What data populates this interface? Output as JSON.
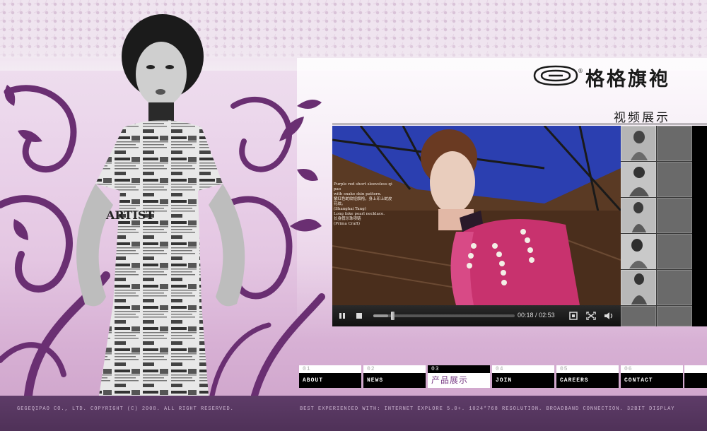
{
  "brand": {
    "name": "格格旗袍",
    "registered_mark": "®"
  },
  "section_title": "视频展示",
  "video": {
    "caption_lines": [
      "Purple red short sleeveless qi pao",
      "with snake skin pattern.",
      "紫红色蛇纹短旗袍，身上印上蛇皮",
      "花纹。",
      "(Shanghai Tang)",
      "Long fake pearl necklace.",
      "长身假珍珠项链",
      "(Prima Craft)"
    ],
    "current_time": "00:18",
    "separator": "/",
    "duration": "02:53",
    "progress_fraction": 0.104,
    "controls": [
      "play-icon",
      "stop-icon",
      "window-icon",
      "fullscreen-icon",
      "volume-icon"
    ]
  },
  "nav": {
    "items": [
      {
        "num": "01",
        "label": "ABOUT",
        "active": false
      },
      {
        "num": "02",
        "label": "NEWS",
        "active": false
      },
      {
        "num": "03",
        "label": "产品展示",
        "active": true
      },
      {
        "num": "04",
        "label": "JOIN",
        "active": false
      },
      {
        "num": "05",
        "label": "CAREERS",
        "active": false
      },
      {
        "num": "06",
        "label": "CONTACT",
        "active": false
      }
    ]
  },
  "footer": {
    "left": "GEGEQIPAO CO., LTD. COPYRIGHT (C) 2008. ALL RIGHT RESERVED.",
    "right": "BEST EXPERIENCED WITH: INTERNET EXPLORE 5.0+. 1024*768 RESOLUTION. BROADBAND CONNECTION. 32BIT DISPLAY"
  },
  "colors": {
    "accent": "#7a3d86",
    "footer_bg": "#5e3c68",
    "swirl": "#6a2f72"
  }
}
